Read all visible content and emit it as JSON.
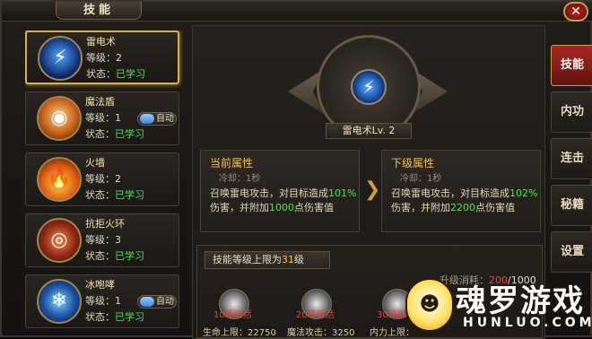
{
  "window": {
    "title": "技能",
    "close_icon": "✕"
  },
  "skills": [
    {
      "name": "雷电术",
      "level": "等级：2",
      "status_label": "状态：",
      "status": "已学习",
      "icon": "⚡",
      "auto": ""
    },
    {
      "name": "魔法盾",
      "level": "等级：1",
      "status_label": "状态：",
      "status": "已学习",
      "icon": "◉",
      "auto": "自动"
    },
    {
      "name": "火墙",
      "level": "等级：2",
      "status_label": "状态：",
      "status": "已学习",
      "icon": "🔥",
      "auto": ""
    },
    {
      "name": "抗拒火环",
      "level": "等级：3",
      "status_label": "状态：",
      "status": "已学习",
      "icon": "◎",
      "auto": ""
    },
    {
      "name": "冰咆哮",
      "level": "等级：1",
      "status_label": "状态：",
      "status": "已学习",
      "icon": "❄",
      "auto": "自动"
    }
  ],
  "detail": {
    "emblem_label": "雷电术Lv. 2",
    "emblem_icon": "⚡",
    "current": {
      "title": "当前属性",
      "cooldown": "冷却：1秒",
      "desc_a": "召唤雷电攻击，对目标造成",
      "pct": "101%",
      "desc_b": "伤害，并附加",
      "bonus": "1000",
      "desc_c": "点伤害值"
    },
    "next": {
      "title": "下级属性",
      "cooldown": "冷却：1秒",
      "desc_a": "召唤雷电攻击，对目标造成",
      "pct": "102%",
      "desc_b": "伤害，并附加",
      "bonus": "2200",
      "desc_c": "点伤害值"
    },
    "arrow_icon": "❯",
    "cap_text": "技能等级上限为",
    "cap_value": "31",
    "cap_suffix": "级",
    "cost_label": "升级消耗：",
    "cost_current": "200",
    "cost_max": "/1000",
    "requirements": [
      {
        "text": "10级激活",
        "stat": "生命上限：22750"
      },
      {
        "text": "20级激活",
        "stat": "魔法攻击：3250"
      },
      {
        "text": "30级激",
        "stat": "内力上限："
      }
    ]
  },
  "tabs": [
    "技能",
    "内功",
    "连击",
    "秘籍",
    "设置"
  ],
  "watermark": {
    "text": "魂罗游戏",
    "sub": "HUNLUO.COM"
  },
  "colors": {
    "accent": "#d7b052",
    "learned": "#55e05a",
    "warning": "#e84438",
    "active_tab": "#a8291f"
  }
}
